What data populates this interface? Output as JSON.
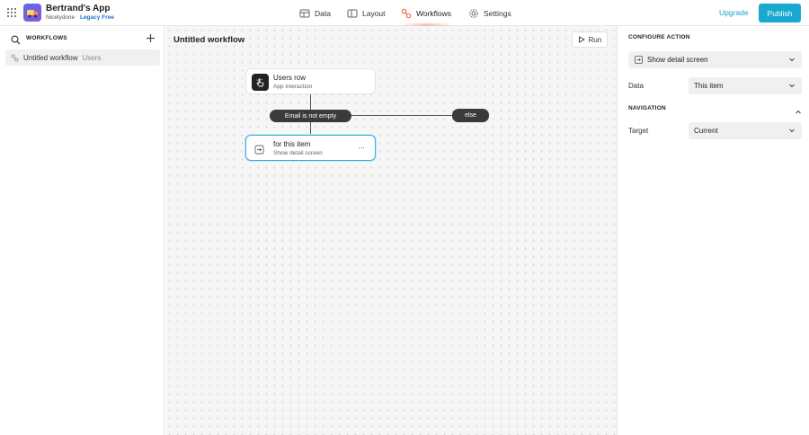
{
  "header": {
    "app_name": "Bertrand's App",
    "workspace": "Nicelydone",
    "separator": "·",
    "plan": "Legacy Free",
    "nav": {
      "data": "Data",
      "layout": "Layout",
      "workflows": "Workflows",
      "settings": "Settings"
    },
    "upgrade_label": "Upgrade",
    "publish_label": "Publish"
  },
  "sidebar": {
    "title": "WORKFLOWS",
    "items": [
      {
        "name": "Untitled workflow",
        "table": "Users"
      }
    ]
  },
  "canvas": {
    "title": "Untitled workflow",
    "run_label": "Run",
    "trigger": {
      "title": "Users row",
      "subtitle": "App interaction"
    },
    "condition": "Email is not empty",
    "else_label": "else",
    "action": {
      "title": "for this item",
      "subtitle": "Show detail screen",
      "menu": "···"
    }
  },
  "panel": {
    "configure_heading": "CONFIGURE ACTION",
    "action_value": "Show detail screen",
    "data_label": "Data",
    "data_value": "This item",
    "navigation_heading": "NAVIGATION",
    "target_label": "Target",
    "target_value": "Current"
  },
  "colors": {
    "accent": "#19a9cf",
    "node_selected_border": "#3bb0d6",
    "pill_bg": "#3a3a3a",
    "plan_link": "#1a73c9"
  },
  "icons": {
    "apps_grid": "apps-grid-icon",
    "data": "table-icon",
    "layout": "layout-icon",
    "workflows": "workflow-icon",
    "settings": "gear-icon",
    "search": "search-icon",
    "add": "plus-icon",
    "run": "play-icon",
    "trigger": "tap-icon",
    "action": "screen-arrow-icon",
    "chevron": "chevron-down-icon",
    "collapse": "chevron-up-icon"
  }
}
